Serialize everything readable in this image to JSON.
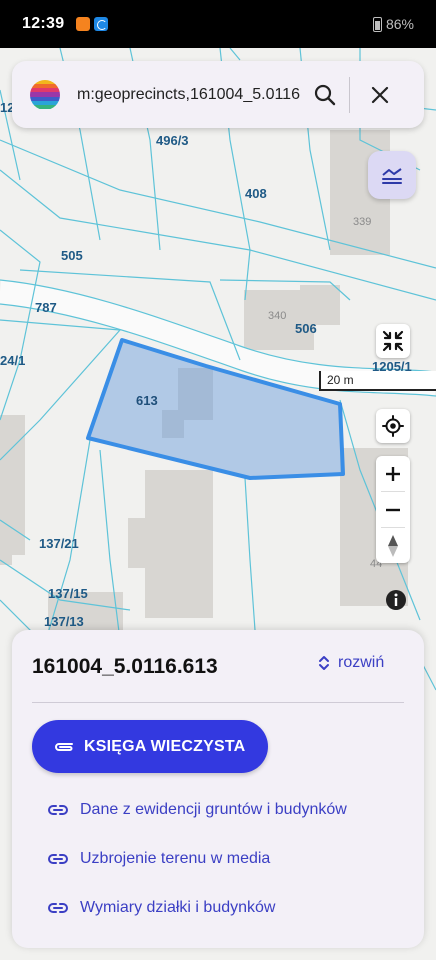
{
  "status_bar": {
    "time": "12:39",
    "battery": "86%"
  },
  "search": {
    "query": "m:geoprecincts,161004_5.0116"
  },
  "map": {
    "parcel_labels": [
      "496/3",
      "408",
      "505",
      "787",
      "506",
      "1205/1",
      "613",
      "137/21",
      "137/15",
      "137/13",
      "24/1",
      "12"
    ],
    "building_labels": [
      "339",
      "340",
      "44"
    ],
    "scale_label": "20 m",
    "selection_color": "#3a8ee6",
    "parcel_line_color": "#5ec3d8"
  },
  "sheet": {
    "title": "161004_5.0116.613",
    "expand_label": "rozwiń",
    "primary_button": "KSIĘGA WIECZYSTA",
    "links": [
      "Dane z ewidencji gruntów i budynków",
      "Uzbrojenie terenu w media",
      "Wymiary działki i budynków"
    ]
  }
}
